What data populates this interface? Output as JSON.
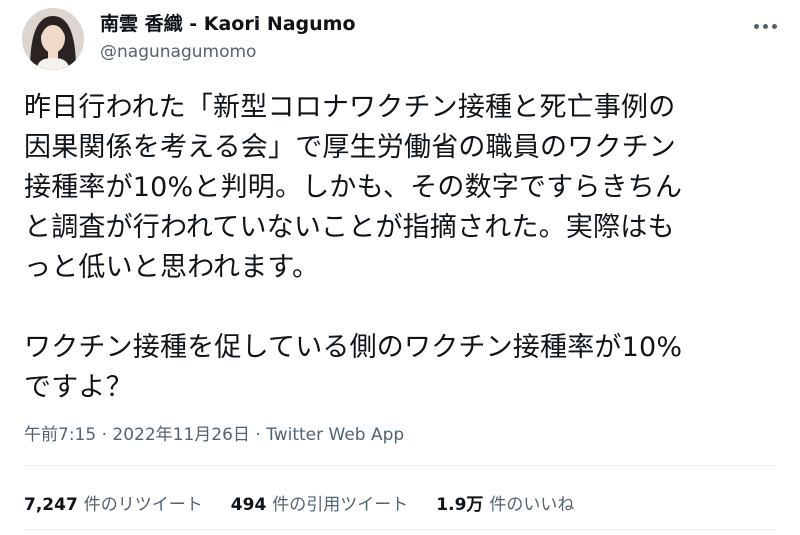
{
  "user": {
    "display_name": "南雲 香織 - Kaori Nagumo",
    "handle": "@nagunagumomo",
    "avatar_icon": "avatar-photo"
  },
  "tweet": {
    "lines_para1": [
      "昨日行われた「新型コロナワクチン接種と死亡事例の",
      "因果関係を考える会」で厚生労働省の職員のワクチン",
      "接種率が10%と判明。しかも、その数字ですらきちん",
      "と調査が行われていないことが指摘された。実際はも",
      "っと低いと思われます。"
    ],
    "lines_para2": [
      "ワクチン接種を促している側のワクチン接種率が10%",
      "ですよ？"
    ]
  },
  "meta": {
    "time": "午前7:15",
    "sep1": " · ",
    "date": "2022年11月26日",
    "sep2": " · ",
    "source": "Twitter Web App"
  },
  "stats": {
    "retweets": {
      "count": "7,247",
      "label": "件のリツイート"
    },
    "quotes": {
      "count": "494",
      "label": "件の引用ツイート"
    },
    "likes": {
      "count": "1.9万",
      "label": "件のいいね"
    }
  },
  "colors": {
    "text": "#0f1419",
    "secondary": "#536471",
    "divider": "#eff3f4"
  }
}
